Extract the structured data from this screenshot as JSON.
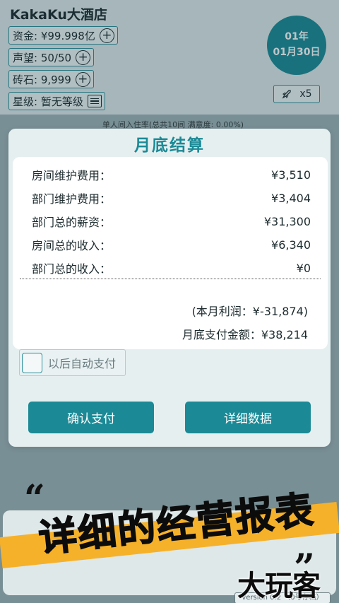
{
  "header": {
    "hotel_name": "KakaKu大酒店",
    "funds": "资金: ¥99.998亿",
    "reputation": "声望: 50/50",
    "gems": "砖石: 9,999",
    "rating": "星级: 暂无等级",
    "date_year": "01年",
    "date_day": "01月30日",
    "speed": "x5"
  },
  "occupancy_text": "单人间入住率(总共10间 满意度: 0.00%)",
  "modal": {
    "title": "月底结算",
    "items": [
      {
        "label": "房间维护费用：",
        "value": "¥3,510"
      },
      {
        "label": "部门维护费用：",
        "value": "¥3,404"
      },
      {
        "label": "部门总的薪资：",
        "value": "¥31,300"
      },
      {
        "label": "房间总的收入：",
        "value": "¥6,340"
      },
      {
        "label": "部门总的收入：",
        "value": "¥0"
      }
    ],
    "profit": "(本月利润：¥-31,874)",
    "total_due": "月底支付金额：¥38,214",
    "auto_pay_label": "以后自动支付",
    "confirm_label": "确认支付",
    "details_label": "详细数据"
  },
  "promo": {
    "quote_open": "“",
    "quote_close": "”",
    "headline": "详细的经营报表",
    "watermark": "大玩客",
    "version": "version 0.2 （0号存档）"
  },
  "colors": {
    "accent": "#1b8a96",
    "promo_stripe": "#f6b12a"
  }
}
